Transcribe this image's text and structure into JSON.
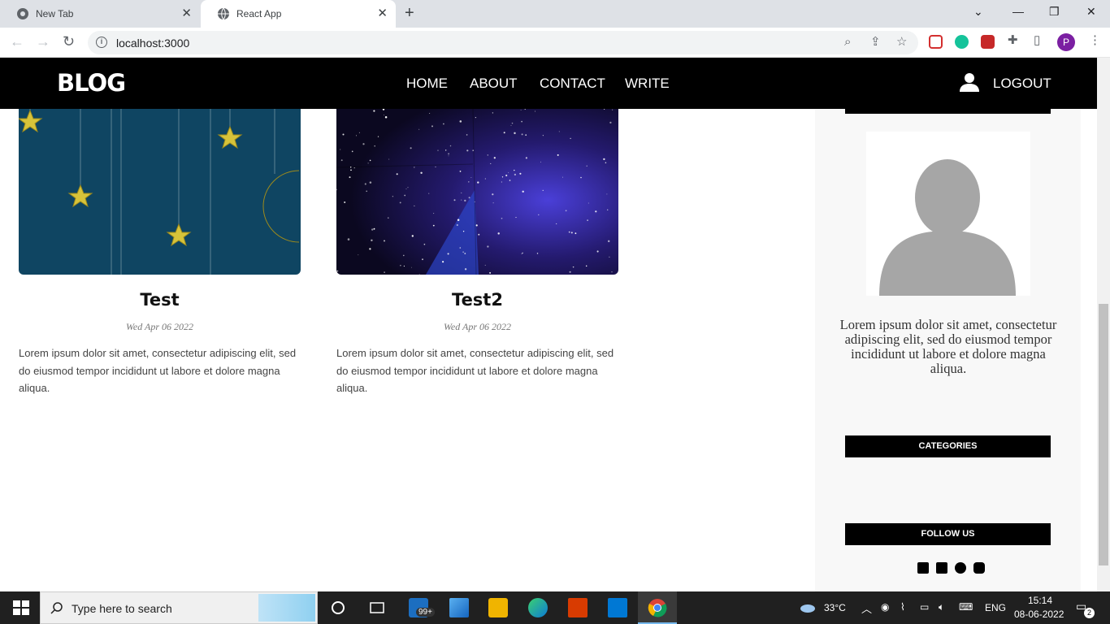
{
  "browser": {
    "tabs": [
      {
        "label": "New Tab"
      },
      {
        "label": "React App"
      }
    ],
    "url": "localhost:3000",
    "profile_initial": "P"
  },
  "site": {
    "logo": "BLOG",
    "nav": [
      "HOME",
      "ABOUT",
      "CONTACT",
      "WRITE"
    ],
    "logout": "LOGOUT"
  },
  "posts": [
    {
      "title": "Test",
      "date": "Wed Apr 06 2022",
      "desc": "Lorem ipsum dolor sit amet, consectetur adipiscing elit, sed do eiusmod tempor incididunt ut labore et dolore magna aliqua.",
      "image": "stars-and-moon"
    },
    {
      "title": "Test2",
      "date": "Wed Apr 06 2022",
      "desc": "Lorem ipsum dolor sit amet, consectetur adipiscing elit, sed do eiusmod tempor incididunt ut labore et dolore magna aliqua.",
      "image": "starry-galaxy"
    }
  ],
  "sidebar": {
    "about": "Lorem ipsum dolor sit amet, consectetur adipiscing elit, sed do eiusmod tempor incididunt ut labore et dolore magna aliqua.",
    "categories_title": "CATEGORIES",
    "follow_title": "FOLLOW US",
    "social_icons": [
      "facebook-icon",
      "twitter-icon",
      "pinterest-icon",
      "instagram-icon"
    ]
  },
  "taskbar": {
    "search_placeholder": "Type here to search",
    "mail_badge": "99+",
    "temperature": "33°C",
    "language": "ENG",
    "time": "15:14",
    "date": "08-06-2022",
    "notifications": "2"
  }
}
